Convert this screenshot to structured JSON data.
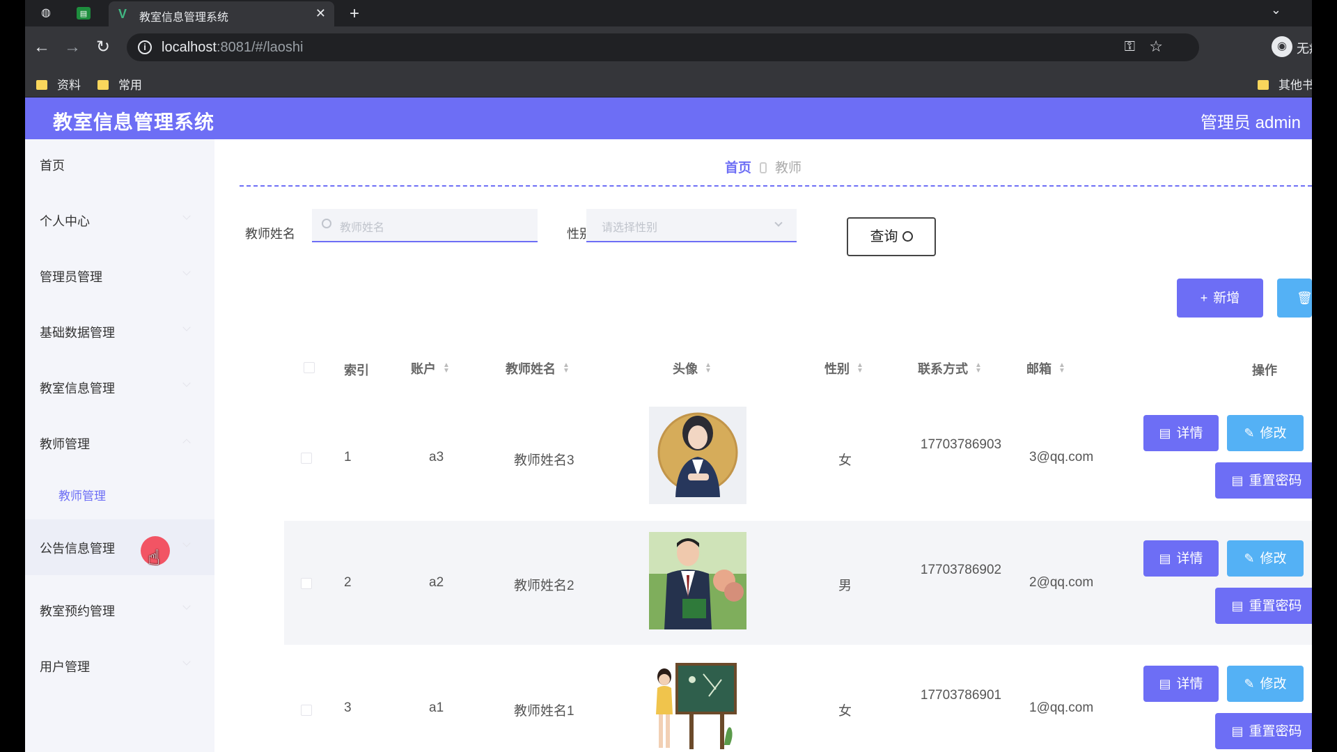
{
  "browser": {
    "tab_title": "教室信息管理系统",
    "tab_fav": "V",
    "url_host": "localhost",
    "url_rest": ":8081/#/laoshi",
    "profile_label": "无痕",
    "bookmarks": [
      "资料",
      "常用"
    ],
    "bookmarks_right": "其他书签"
  },
  "app": {
    "title": "教室信息管理系统",
    "user": "管理员 admin",
    "accent": "#6d6ef5"
  },
  "sidebar": {
    "items": [
      {
        "label": "首页"
      },
      {
        "label": "个人中心"
      },
      {
        "label": "管理员管理"
      },
      {
        "label": "基础数据管理"
      },
      {
        "label": "教室信息管理"
      },
      {
        "label": "教师管理"
      },
      {
        "label": "教师管理"
      },
      {
        "label": "公告信息管理"
      },
      {
        "label": "教室预约管理"
      },
      {
        "label": "用户管理"
      }
    ]
  },
  "breadcrumb": {
    "home": "首页",
    "current": "教师"
  },
  "search": {
    "name_label": "教师姓名",
    "name_placeholder": "教师姓名",
    "gender_label": "性别",
    "gender_placeholder": "请选择性别",
    "query_button": "查询"
  },
  "toolbar": {
    "add_label": "新增",
    "delete_label": "删除"
  },
  "table": {
    "headers": [
      "索引",
      "账户",
      "教师姓名",
      "头像",
      "性别",
      "联系方式",
      "邮箱",
      "操作"
    ],
    "rows": [
      {
        "index": "1",
        "account": "a3",
        "name": "教师姓名3",
        "gender": "女",
        "phone": "17703786903",
        "email": "3@qq.com"
      },
      {
        "index": "2",
        "account": "a2",
        "name": "教师姓名2",
        "gender": "男",
        "phone": "17703786902",
        "email": "2@qq.com"
      },
      {
        "index": "3",
        "account": "a1",
        "name": "教师姓名1",
        "gender": "女",
        "phone": "17703786901",
        "email": "1@qq.com"
      }
    ],
    "actions": {
      "detail": "详情",
      "edit": "修改",
      "reset_password": "重置密码"
    }
  }
}
